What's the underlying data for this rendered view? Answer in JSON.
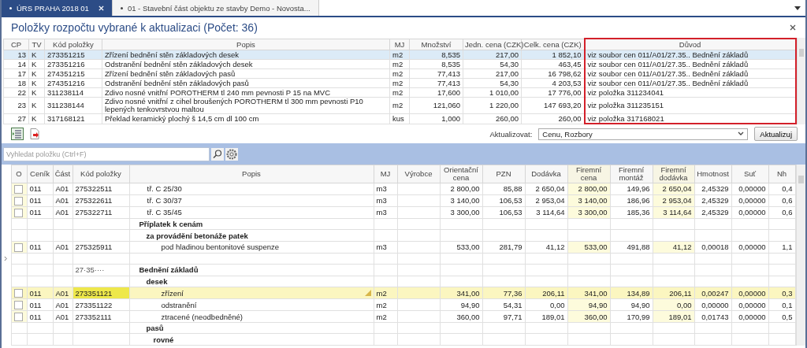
{
  "tabs": [
    {
      "label": "ÚRS PRAHA 2018 01",
      "selected": true,
      "closable": true
    },
    {
      "label": "01 - Stavební část objektu ze stavby Demo - Novosta...",
      "selected": false,
      "closable": false
    }
  ],
  "panel": {
    "title": "Položky rozpočtu vybrané k aktualizaci (Počet: 36)",
    "columns": [
      {
        "label": "CP",
        "kind": "number",
        "highlighted": false
      },
      {
        "label": "TV",
        "kind": "text",
        "highlighted": false
      },
      {
        "label": "Kód položky",
        "kind": "text",
        "highlighted": false
      },
      {
        "label": "Popis",
        "kind": "text",
        "highlighted": false
      },
      {
        "label": "MJ",
        "kind": "text",
        "highlighted": false
      },
      {
        "label": "Množství",
        "kind": "number",
        "highlighted": false
      },
      {
        "label": "Jedn. cena (CZK)",
        "kind": "number",
        "highlighted": false
      },
      {
        "label": "Celk. cena (CZK)",
        "kind": "number",
        "highlighted": false
      },
      {
        "label": "Důvod",
        "kind": "text",
        "highlighted": true
      }
    ],
    "rows": [
      {
        "selected": true,
        "cells": [
          "13",
          "K",
          "273351215",
          "Zřízení bednění stěn základových desek",
          "m2",
          "8,535",
          "217,00",
          "1 852,10",
          "viz soubor cen 011/A01/27.35.. Bednění základů"
        ]
      },
      {
        "selected": false,
        "cells": [
          "14",
          "K",
          "273351216",
          "Odstranění bednění stěn základových desek",
          "m2",
          "8,535",
          "54,30",
          "463,45",
          "viz soubor cen 011/A01/27.35.. Bednění základů"
        ]
      },
      {
        "selected": false,
        "cells": [
          "17",
          "K",
          "274351215",
          "Zřízení bednění stěn základových pasů",
          "m2",
          "77,413",
          "217,00",
          "16 798,62",
          "viz soubor cen 011/A01/27.35.. Bednění základů"
        ]
      },
      {
        "selected": false,
        "cells": [
          "18",
          "K",
          "274351216",
          "Odstranění bednění stěn základových pasů",
          "m2",
          "77,413",
          "54,30",
          "4 203,53",
          "viz soubor cen 011/A01/27.35.. Bednění základů"
        ]
      },
      {
        "selected": false,
        "cells": [
          "22",
          "K",
          "311238114",
          "Zdivo nosné vnitřní POROTHERM tl 240 mm pevnosti P 15 na MVC",
          "m2",
          "17,600",
          "1 010,00",
          "17 776,00",
          "viz položka 311234041"
        ]
      },
      {
        "selected": false,
        "cells": [
          "23",
          "K",
          "311238144",
          "Zdivo nosné vnitřní z cihel broušených POROTHERM tl 300 mm pevnosti P10 lepených tenkovrstvou maltou",
          "m2",
          "121,060",
          "1 220,00",
          "147 693,20",
          "viz položka 311235151"
        ]
      },
      {
        "selected": false,
        "cells": [
          "27",
          "K",
          "317168121",
          "Překlad keramický plochý š 14,5 cm dl 100 cm",
          "kus",
          "1,000",
          "260,00",
          "260,00",
          "viz položka 317168021"
        ]
      }
    ]
  },
  "update_bar": {
    "label": "Aktualizovat:",
    "value": "Cenu, Rozbory",
    "button": "Aktualizuj"
  },
  "search": {
    "placeholder": "Vyhledat položku (Ctrl+F)"
  },
  "grid": {
    "columns": [
      {
        "label": "Ceník",
        "kind": "text",
        "tinted": false
      },
      {
        "label": "Část",
        "kind": "text",
        "tinted": false
      },
      {
        "label": "Kód položky",
        "kind": "text",
        "tinted": false
      },
      {
        "label": "Popis",
        "kind": "text",
        "tinted": false
      },
      {
        "label": "MJ",
        "kind": "text",
        "tinted": false
      },
      {
        "label": "Výrobce",
        "kind": "text",
        "tinted": false
      },
      {
        "label": "Orientační cena",
        "kind": "number",
        "tinted": false
      },
      {
        "label": "PZN",
        "kind": "number",
        "tinted": false
      },
      {
        "label": "Dodávka",
        "kind": "number",
        "tinted": false
      },
      {
        "label": "Firemní cena",
        "kind": "number",
        "tinted": true
      },
      {
        "label": "Firemní montáž",
        "kind": "number",
        "tinted": false
      },
      {
        "label": "Firemní dodávka",
        "kind": "number",
        "tinted": true
      },
      {
        "label": "Hmotnost",
        "kind": "number",
        "tinted": false
      },
      {
        "label": "Suť",
        "kind": "number",
        "tinted": false
      },
      {
        "label": "Nh",
        "kind": "number",
        "tinted": false
      }
    ],
    "check_header": "O",
    "rows": [
      {
        "kind": "item",
        "checked": false,
        "selected": false,
        "cells": [
          "011",
          "A01",
          "275322511",
          "tř. C 25/30",
          "m3",
          "",
          "2 800,00",
          "85,88",
          "2 650,04",
          "2 800,00",
          "149,96",
          "2 650,04",
          "2,45329",
          "0,00000",
          "0,4"
        ]
      },
      {
        "kind": "item",
        "checked": false,
        "selected": false,
        "cells": [
          "011",
          "A01",
          "275322611",
          "tř. C 30/37",
          "m3",
          "",
          "3 140,00",
          "106,53",
          "2 953,04",
          "3 140,00",
          "186,96",
          "2 953,04",
          "2,45329",
          "0,00000",
          "0,6"
        ]
      },
      {
        "kind": "item",
        "checked": false,
        "selected": false,
        "cells": [
          "011",
          "A01",
          "275322711",
          "tř. C 35/45",
          "m3",
          "",
          "3 300,00",
          "106,53",
          "3 114,64",
          "3 300,00",
          "185,36",
          "3 114,64",
          "2,45329",
          "0,00000",
          "0,6"
        ]
      },
      {
        "kind": "group",
        "label": "Příplatek k cenám",
        "children": [
          {
            "kind": "group",
            "label": "za provádění betonáže patek",
            "children": [
              {
                "kind": "item",
                "checked": false,
                "selected": false,
                "cells": [
                  "011",
                  "A01",
                  "275325911",
                  "pod hladinou bentonitové suspenze",
                  "m3",
                  "",
                  "533,00",
                  "281,79",
                  "41,12",
                  "533,00",
                  "491,88",
                  "41,12",
                  "0,00018",
                  "0,00000",
                  "1,1"
                ]
              }
            ]
          }
        ]
      },
      {
        "kind": "blank",
        "current": true
      },
      {
        "kind": "group",
        "code": "27·35····",
        "label": "Bednění základů",
        "children": [
          {
            "kind": "group",
            "label": "desek",
            "children": [
              {
                "kind": "item",
                "checked": false,
                "selected": true,
                "cells": [
                  "011",
                  "A01",
                  "273351121",
                  "zřízení",
                  "m2",
                  "",
                  "341,00",
                  "77,36",
                  "206,11",
                  "341,00",
                  "134,89",
                  "206,11",
                  "0,00247",
                  "0,00000",
                  "0,3"
                ]
              },
              {
                "kind": "item",
                "checked": false,
                "selected": false,
                "cells": [
                  "011",
                  "A01",
                  "273351122",
                  "odstranění",
                  "m2",
                  "",
                  "94,90",
                  "54,31",
                  "0,00",
                  "94,90",
                  "94,90",
                  "0,00",
                  "0,00000",
                  "0,00000",
                  "0,1"
                ]
              },
              {
                "kind": "item",
                "checked": false,
                "selected": false,
                "cells": [
                  "011",
                  "A01",
                  "273352111",
                  "ztracené (neodbedněné)",
                  "m2",
                  "",
                  "360,00",
                  "97,71",
                  "189,01",
                  "360,00",
                  "170,99",
                  "189,01",
                  "0,01743",
                  "0,00000",
                  "0,5"
                ]
              }
            ]
          },
          {
            "kind": "group",
            "label": "pasů",
            "children": [
              {
                "kind": "group",
                "label": "rovné"
              }
            ]
          }
        ]
      }
    ]
  }
}
